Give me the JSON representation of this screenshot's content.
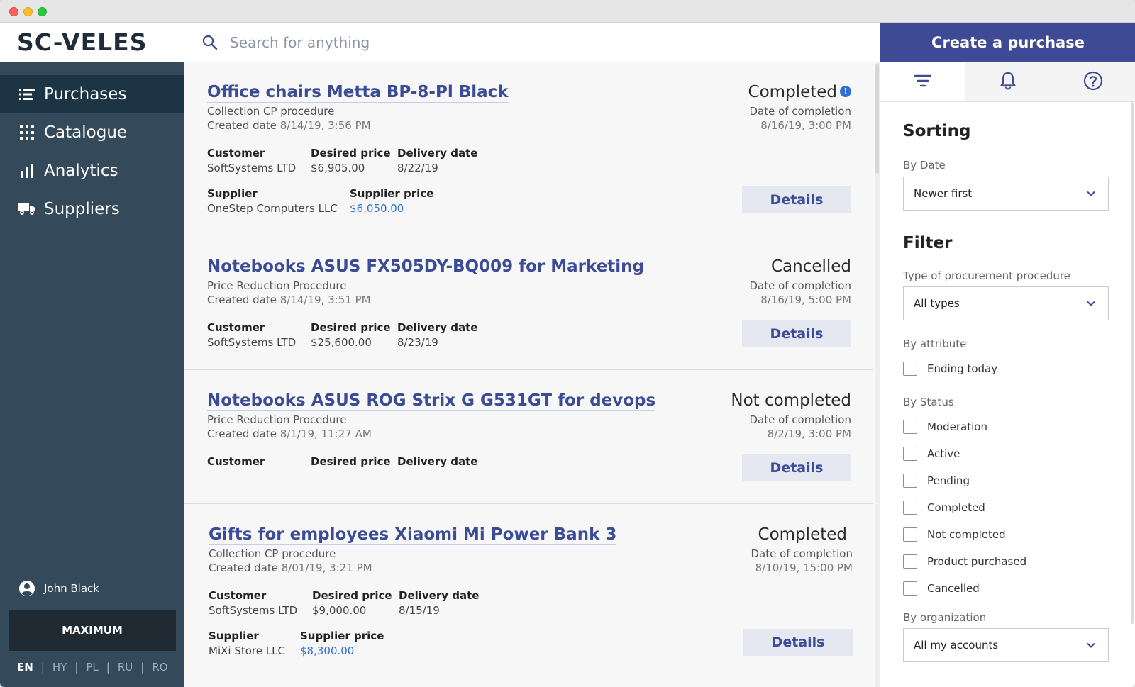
{
  "app": {
    "logo": "SC-VELES"
  },
  "sidebar": {
    "items": [
      {
        "label": "Purchases",
        "icon": "list-icon",
        "active": true
      },
      {
        "label": "Catalogue",
        "icon": "grid-icon",
        "active": false
      },
      {
        "label": "Analytics",
        "icon": "bar-chart-icon",
        "active": false
      },
      {
        "label": "Suppliers",
        "icon": "truck-icon",
        "active": false
      }
    ],
    "user": "John Black",
    "plan": "MAXIMUM",
    "languages": [
      "EN",
      "HY",
      "PL",
      "RU",
      "RO"
    ],
    "active_language": "EN"
  },
  "search": {
    "placeholder": "Search for anything"
  },
  "create_button": "Create a purchase",
  "purchases": [
    {
      "title": "Office chairs Metta BP-8-Pl Black",
      "procedure": "Collection CP procedure",
      "created_label": "Created date",
      "created": "8/14/19, 3:56 PM",
      "status": "Completed",
      "status_badge": "!",
      "completion_label": "Date of completion",
      "completion": "8/16/19, 3:00 PM",
      "customer_label": "Customer",
      "customer": "SoftSystems LTD",
      "desired_label": "Desired price",
      "desired": "$6,905.00",
      "delivery_label": "Delivery date",
      "delivery": "8/22/19",
      "supplier_label": "Supplier",
      "supplier": "OneStep Computers LLC",
      "supplier_price_label": "Supplier price",
      "supplier_price": "$6,050.00",
      "button": "Details"
    },
    {
      "title": "Notebooks ASUS FX505DY-BQ009 for Marketing",
      "procedure": "Price Reduction Procedure",
      "created_label": "Created date",
      "created": "8/14/19, 3:51 PM",
      "status": "Cancelled",
      "completion_label": "Date of completion",
      "completion": "8/16/19, 5:00 PM",
      "customer_label": "Customer",
      "customer": "SoftSystems LTD",
      "desired_label": "Desired price",
      "desired": "$25,600.00",
      "delivery_label": "Delivery date",
      "delivery": "8/23/19",
      "button": "Details"
    },
    {
      "title": "Notebooks ASUS ROG Strix G G531GT for devops",
      "procedure": "Price Reduction Procedure",
      "created_label": "Created date",
      "created": "8/1/19, 11:27 AM",
      "status": "Not completed",
      "completion_label": "Date of completion",
      "completion": "8/2/19, 3:00 PM",
      "customer_label": "Customer",
      "desired_label": "Desired price",
      "delivery_label": "Delivery date",
      "button": "Details"
    },
    {
      "title": "Gifts for employees Xiaomi Mi Power Bank 3",
      "procedure": "Collection CP procedure",
      "created_label": "Created date",
      "created": "8/01/19, 3:21 PM",
      "status": "Completed",
      "completion_label": "Date of completion",
      "completion": "8/10/19, 15:00 PM",
      "customer_label": "Customer",
      "customer": "SoftSystems LTD",
      "desired_label": "Desired price",
      "desired": "$9,000.00",
      "delivery_label": "Delivery date",
      "delivery": "8/15/19",
      "supplier_label": "Supplier",
      "supplier": "MiXi Store LLC",
      "supplier_price_label": "Supplier price",
      "supplier_price": "$8,300.00",
      "button": "Details"
    }
  ],
  "panel": {
    "tabs": [
      "filter-icon",
      "bell-icon",
      "help-icon"
    ],
    "sorting_title": "Sorting",
    "by_date_label": "By Date",
    "by_date_value": "Newer first",
    "filter_title": "Filter",
    "type_label": "Type of procurement procedure",
    "type_value": "All types",
    "attribute_label": "By attribute",
    "attribute_options": [
      "Ending today"
    ],
    "status_label": "By Status",
    "status_options": [
      "Moderation",
      "Active",
      "Pending",
      "Completed",
      "Not completed",
      "Product purchased",
      "Cancelled"
    ],
    "organization_label": "By organization",
    "organization_value": "All my accounts"
  },
  "colors": {
    "accent": "#3e4a93",
    "sidebar": "#34495a",
    "sidebar_active": "#1d3445",
    "link": "#2f6fd6"
  }
}
